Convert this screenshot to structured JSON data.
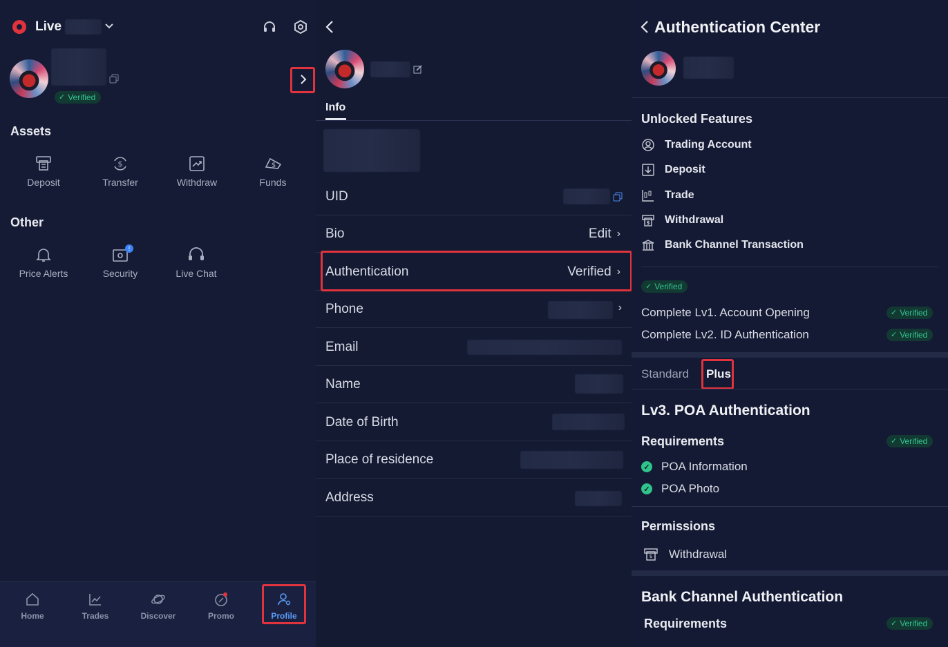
{
  "profile": {
    "account_mode": "Live",
    "verified_label": "Verified",
    "assets_title": "Assets",
    "assets": [
      "Deposit",
      "Transfer",
      "Withdraw",
      "Funds"
    ],
    "other_title": "Other",
    "other": [
      "Price Alerts",
      "Security",
      "Live Chat"
    ],
    "security_badge": "!",
    "nav": [
      "Home",
      "Trades",
      "Discover",
      "Promo",
      "Profile"
    ],
    "active_nav": "Profile"
  },
  "info": {
    "tab": "Info",
    "rows": [
      {
        "label": "UID",
        "value": ""
      },
      {
        "label": "Bio",
        "value": "Edit"
      },
      {
        "label": "Authentication",
        "value": "Verified"
      },
      {
        "label": "Phone",
        "value": ""
      },
      {
        "label": "Email",
        "value": ""
      },
      {
        "label": "Name",
        "value": ""
      },
      {
        "label": "Date of Birth",
        "value": ""
      },
      {
        "label": "Place of residence",
        "value": ""
      },
      {
        "label": "Address",
        "value": ""
      }
    ]
  },
  "auth": {
    "title": "Authentication Center",
    "unlocked_title": "Unlocked Features",
    "features": [
      "Trading Account",
      "Deposit",
      "Trade",
      "Withdrawal",
      "Bank Channel Transaction"
    ],
    "verified": "Verified",
    "levels": [
      "Complete Lv1. Account Opening",
      "Complete Lv2. ID Authentication"
    ],
    "tabs": [
      "Standard",
      "Plus"
    ],
    "active_tab": "Plus",
    "lv3_title": "Lv3. POA Authentication",
    "requirements_title": "Requirements",
    "requirements": [
      "POA Information",
      "POA Photo"
    ],
    "permissions_title": "Permissions",
    "permissions": [
      "Withdrawal"
    ],
    "bank_title": "Bank Channel Authentication",
    "bank_requirements_title": "Requirements",
    "colors": {
      "accent_red": "#e0333d",
      "verified_green": "#33c58d",
      "active_blue": "#5b9cf5"
    }
  }
}
